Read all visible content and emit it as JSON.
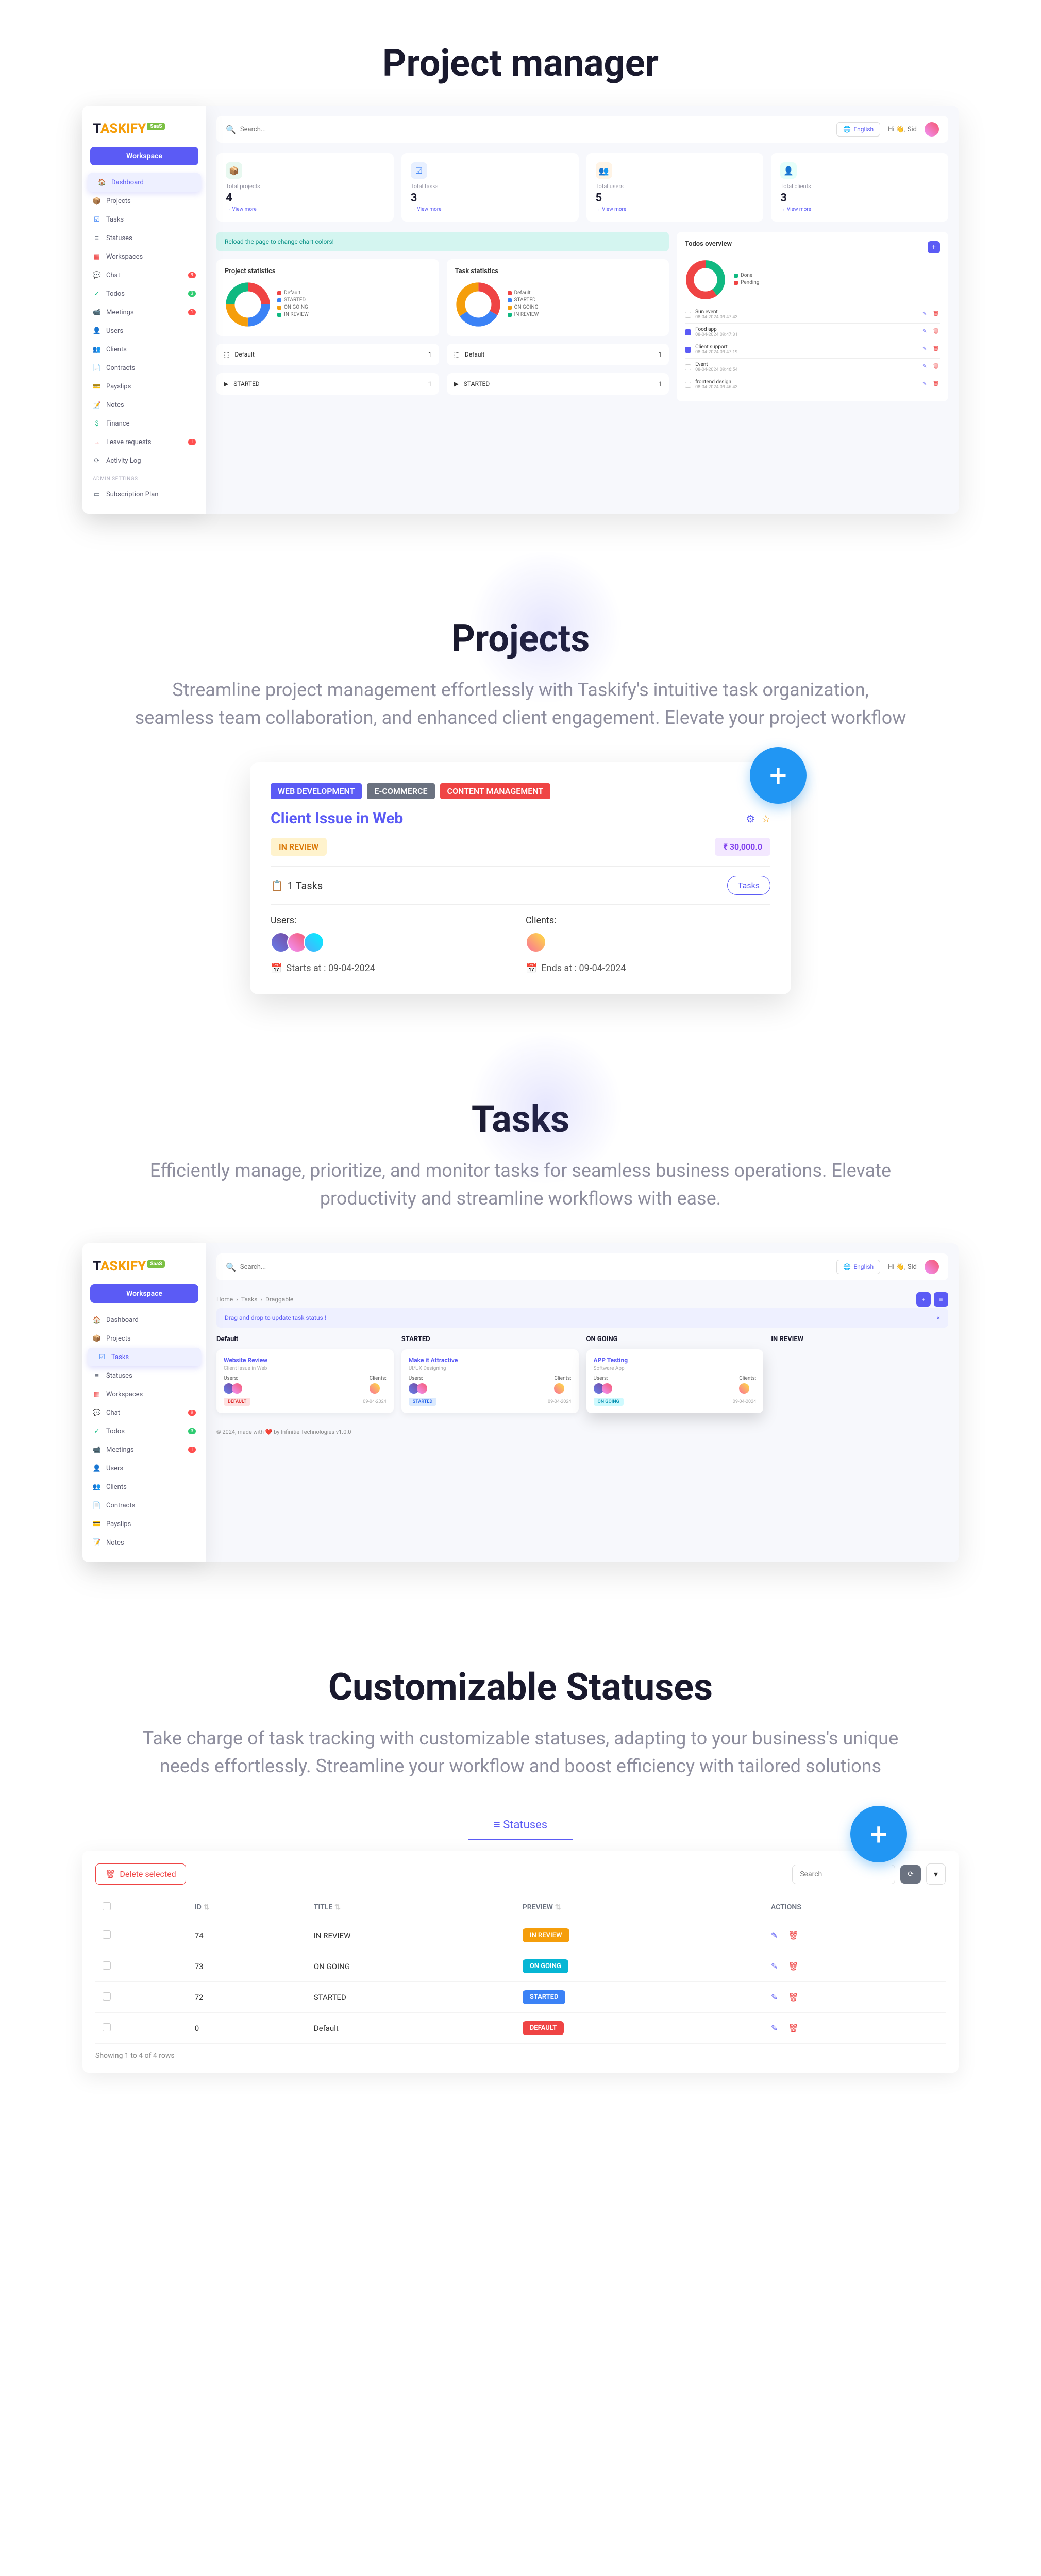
{
  "sections": {
    "pm_title": "Project manager",
    "projects_title": "Projects",
    "projects_desc": "Streamline project management effortlessly with Taskify's intuitive task organization, seamless team collaboration, and enhanced client engagement. Elevate your project workflow",
    "tasks_title": "Tasks",
    "tasks_desc": "Efficiently manage, prioritize, and monitor tasks for seamless business operations. Elevate productivity and streamline workflows with ease.",
    "statuses_title": "Customizable Statuses",
    "statuses_desc": "Take charge of task tracking with customizable statuses, adapting to your business's unique needs effortlessly. Streamline your workflow and boost efficiency with tailored solutions"
  },
  "brand": {
    "name": "TASKIFY",
    "badge": "SaaS"
  },
  "sidebar": {
    "workspace_btn": "Workspace",
    "items": [
      {
        "label": "Dashboard",
        "icon": "🏠",
        "color": "#5b5bf5"
      },
      {
        "label": "Projects",
        "icon": "📦",
        "color": "#f59e0b"
      },
      {
        "label": "Tasks",
        "icon": "☑",
        "color": "#3b82f6"
      },
      {
        "label": "Statuses",
        "icon": "≡",
        "color": "#6b7280"
      },
      {
        "label": "Workspaces",
        "icon": "▦",
        "color": "#ef4444"
      },
      {
        "label": "Chat",
        "icon": "💬",
        "color": "#f59e0b",
        "badge": "9"
      },
      {
        "label": "Todos",
        "icon": "✓",
        "color": "#10b981",
        "badge": "3",
        "badge_color": "green"
      },
      {
        "label": "Meetings",
        "icon": "📹",
        "color": "#10b981",
        "badge": "1"
      },
      {
        "label": "Users",
        "icon": "👤",
        "color": "#5b5bf5"
      },
      {
        "label": "Clients",
        "icon": "👥",
        "color": "#f59e0b"
      },
      {
        "label": "Contracts",
        "icon": "📄",
        "color": "#10b981"
      },
      {
        "label": "Payslips",
        "icon": "💳",
        "color": "#5b5bf5"
      },
      {
        "label": "Notes",
        "icon": "📝",
        "color": "#06b6d4"
      },
      {
        "label": "Finance",
        "icon": "$",
        "color": "#10b981"
      },
      {
        "label": "Leave requests",
        "icon": "→",
        "color": "#ef4444",
        "badge": "1"
      },
      {
        "label": "Activity Log",
        "icon": "⟳",
        "color": "#6b7280"
      }
    ],
    "admin_label": "ADMIN SETTINGS",
    "admin_items": [
      {
        "label": "Subscription Plan",
        "icon": "▭",
        "color": "#6b7280"
      }
    ]
  },
  "topbar": {
    "search_placeholder": "Search...",
    "lang": "English",
    "greeting": "Hi 👋, Sid"
  },
  "stats": [
    {
      "label": "Total projects",
      "value": "4",
      "link": "→ View more",
      "icon": "📦",
      "class": "green"
    },
    {
      "label": "Total tasks",
      "value": "3",
      "link": "→ View more",
      "icon": "☑",
      "class": "blue"
    },
    {
      "label": "Total users",
      "value": "5",
      "link": "→ View more",
      "icon": "👥",
      "class": "orange"
    },
    {
      "label": "Total clients",
      "value": "3",
      "link": "→ View more",
      "icon": "👤",
      "class": "teal"
    }
  ],
  "alert_text": "Reload the page to change chart colors!",
  "charts": {
    "project_title": "Project statistics",
    "task_title": "Task statistics",
    "legend": [
      {
        "label": "Default",
        "color": "#ef4444"
      },
      {
        "label": "STARTED",
        "color": "#3b82f6"
      },
      {
        "label": "ON GOING",
        "color": "#f59e0b"
      },
      {
        "label": "IN REVIEW",
        "color": "#10b981"
      }
    ]
  },
  "chart_data": [
    {
      "type": "pie",
      "title": "Project statistics",
      "series": [
        {
          "name": "Default",
          "value": 1,
          "color": "#ef4444"
        },
        {
          "name": "STARTED",
          "value": 1,
          "color": "#3b82f6"
        },
        {
          "name": "ON GOING",
          "value": 1,
          "color": "#f59e0b"
        },
        {
          "name": "IN REVIEW",
          "value": 1,
          "color": "#10b981"
        }
      ]
    },
    {
      "type": "pie",
      "title": "Task statistics",
      "series": [
        {
          "name": "Default",
          "value": 1,
          "color": "#ef4444"
        },
        {
          "name": "STARTED",
          "value": 1,
          "color": "#3b82f6"
        },
        {
          "name": "ON GOING",
          "value": 1,
          "color": "#f59e0b"
        },
        {
          "name": "IN REVIEW",
          "value": 0,
          "color": "#10b981"
        }
      ]
    },
    {
      "type": "pie",
      "title": "Todos overview",
      "series": [
        {
          "name": "Done",
          "value": 2,
          "color": "#10b981"
        },
        {
          "name": "Pending",
          "value": 3,
          "color": "#ef4444"
        }
      ]
    }
  ],
  "todos": {
    "title": "Todos overview",
    "legend": [
      {
        "label": "Done",
        "color": "#10b981"
      },
      {
        "label": "Pending",
        "color": "#ef4444"
      }
    ],
    "items": [
      {
        "text": "Sun event",
        "date": "08-04-2024 09:47:43",
        "checked": false
      },
      {
        "text": "Food app",
        "date": "08-04-2024 09:47:31",
        "checked": true
      },
      {
        "text": "Client support",
        "date": "08-04-2024 09:47:19",
        "checked": true
      },
      {
        "text": "Event",
        "date": "08-04-2024 09:46:54",
        "checked": false
      },
      {
        "text": "frontend design",
        "date": "08-04-2024 09:46:43",
        "checked": false
      }
    ]
  },
  "status_cards": [
    {
      "icon": "⬚",
      "label": "Default",
      "count": "1"
    },
    {
      "icon": "⬚",
      "label": "Default",
      "count": "1"
    },
    {
      "icon": "▶",
      "label": "STARTED",
      "count": "1"
    },
    {
      "icon": "▶",
      "label": "STARTED",
      "count": "1"
    }
  ],
  "project": {
    "tags": [
      {
        "text": "WEB DEVELOPMENT",
        "class": "blue"
      },
      {
        "text": "E-COMMERCE",
        "class": "gray"
      },
      {
        "text": "CONTENT MANAGEMENT",
        "class": "red"
      }
    ],
    "title": "Client Issue in Web",
    "status": "IN REVIEW",
    "price": "₹ 30,000.0",
    "task_count": "1 Tasks",
    "tasks_btn": "Tasks",
    "users_label": "Users:",
    "clients_label": "Clients:",
    "start_label": "Starts at : 09-04-2024",
    "end_label": "Ends at : 09-04-2024"
  },
  "kanban": {
    "breadcrumb": [
      "Home",
      "Tasks",
      "Draggable"
    ],
    "alert": "Drag and drop to update task status !",
    "cols": [
      "Default",
      "STARTED",
      "ON GOING",
      "IN REVIEW"
    ],
    "cards": [
      {
        "col": 0,
        "title": "Website Review",
        "sub": "Client Issue in Web",
        "users_label": "Users:",
        "clients_label": "Clients:",
        "badge": "DEFAULT",
        "badge_class": "default",
        "date": "09-04-2024"
      },
      {
        "col": 1,
        "title": "Make it Attractive",
        "sub": "UI/UX Designing",
        "users_label": "Users:",
        "clients_label": "Clients:",
        "badge": "STARTED",
        "badge_class": "started",
        "date": "09-04-2024"
      },
      {
        "col": 2,
        "title": "APP Testing",
        "sub": "Software App",
        "users_label": "Users:",
        "clients_label": "Clients:",
        "badge": "ON GOING",
        "badge_class": "ongoing",
        "date": "09-04-2024",
        "elevated": true
      }
    ],
    "footer": "© 2024, made with ❤️ by Infinitie Technologies   v1.0.0"
  },
  "statuses": {
    "tab": "Statuses",
    "delete_btn": "Delete selected",
    "search_placeholder": "Search",
    "headers": [
      "",
      "ID",
      "TITLE",
      "PREVIEW",
      "ACTIONS"
    ],
    "rows": [
      {
        "id": "74",
        "title": "IN REVIEW",
        "preview": "IN REVIEW",
        "class": "review"
      },
      {
        "id": "73",
        "title": "ON GOING",
        "preview": "ON GOING",
        "class": "ongoing"
      },
      {
        "id": "72",
        "title": "STARTED",
        "preview": "STARTED",
        "class": "started"
      },
      {
        "id": "0",
        "title": "Default",
        "preview": "DEFAULT",
        "class": "default"
      }
    ],
    "footer": "Showing 1 to 4 of 4 rows"
  }
}
